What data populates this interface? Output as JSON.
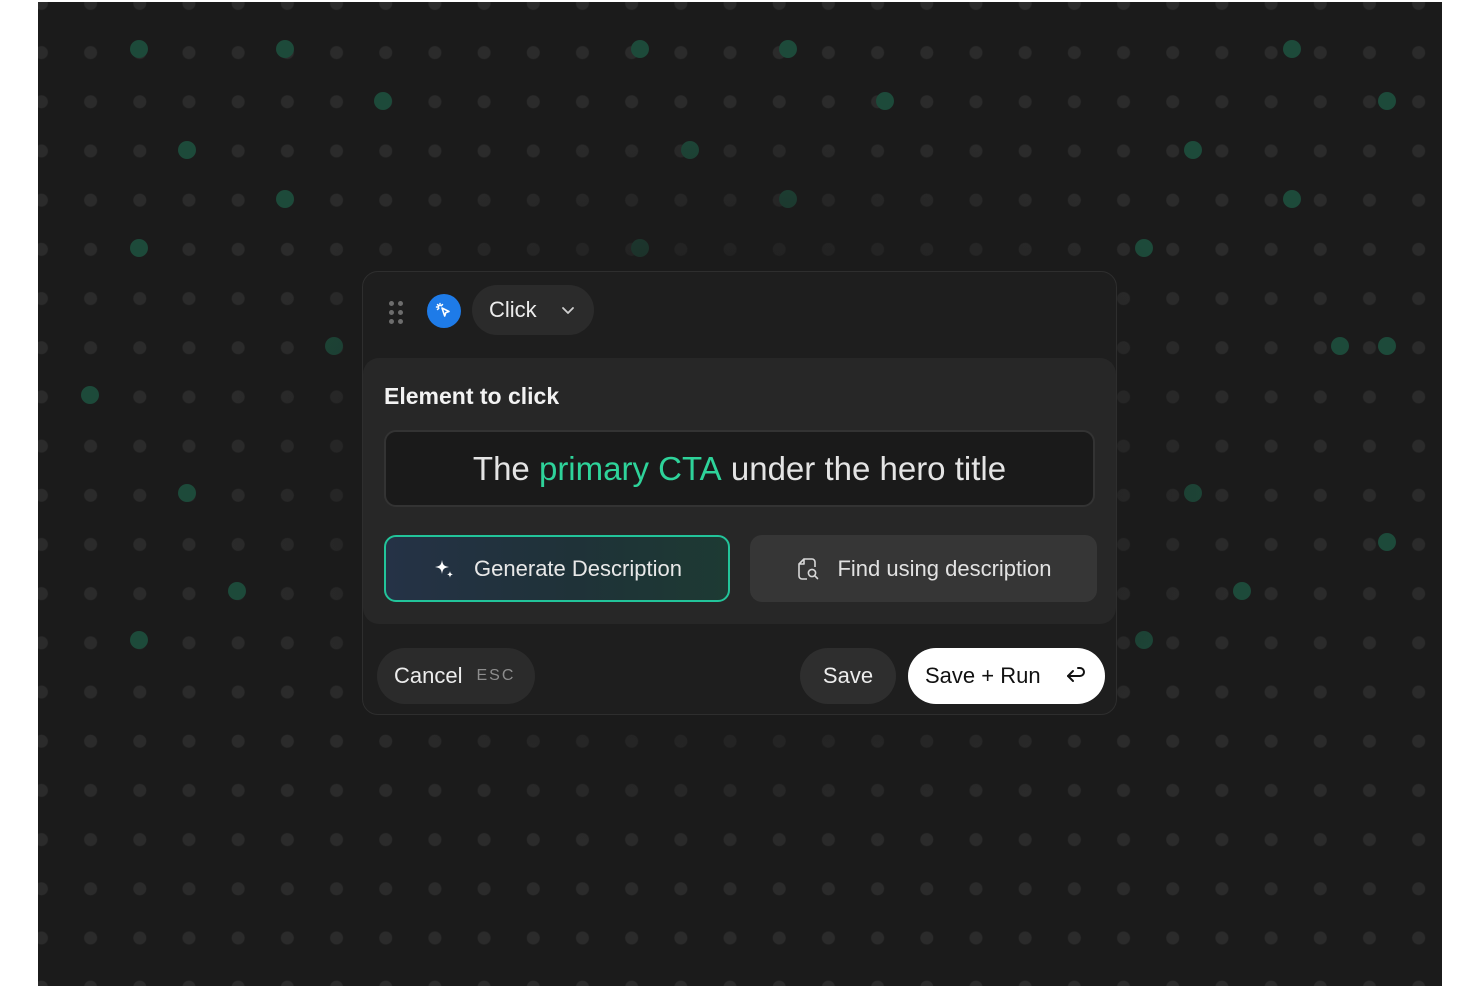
{
  "header": {
    "action_icon": "cursor-click-icon",
    "action_label": "Click",
    "dropdown_icon": "chevron-down-icon"
  },
  "field": {
    "title": "Element to click",
    "description_parts": [
      "The ",
      "primary CTA",
      " under the hero title"
    ]
  },
  "buttons": {
    "generate_label": "Generate Description",
    "generate_icon": "sparkle-icon",
    "find_label": "Find using description",
    "find_icon": "search-document-icon"
  },
  "footer": {
    "cancel_label": "Cancel",
    "cancel_shortcut": "ESC",
    "save_label": "Save",
    "save_run_label": "Save + Run",
    "save_run_icon": "enter-return-icon"
  },
  "colors": {
    "background": "#1b1b1b",
    "accent_green": "#2ed39a",
    "accent_blue": "#1e7be8"
  }
}
